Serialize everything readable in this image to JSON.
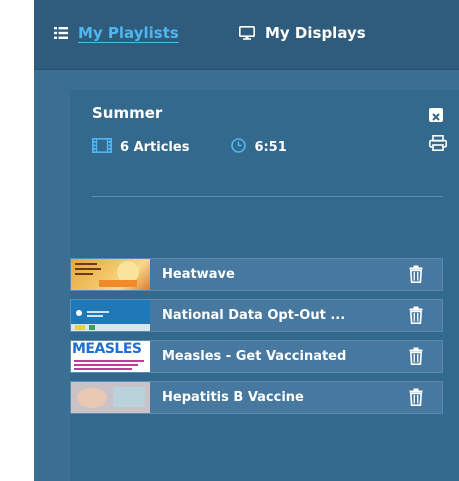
{
  "nav": {
    "playlists_label": "My Playlists",
    "displays_label": "My Displays"
  },
  "playlist": {
    "title": "Summer",
    "articles_count": "6 Articles",
    "duration": "6:51"
  },
  "articles": [
    {
      "title": "Heatwave",
      "thumb": "heatwave"
    },
    {
      "title": "National Data Opt-Out ...",
      "thumb": "data-opt-out"
    },
    {
      "title": "Measles - Get Vaccinated",
      "thumb": "measles",
      "thumb_text": "MEASLES"
    },
    {
      "title": "Hepatitis B Vaccine",
      "thumb": "hepatitis-b"
    }
  ],
  "icons": {
    "playlists": "list-icon",
    "displays": "monitor-icon",
    "articles": "film-icon",
    "duration": "clock-icon",
    "close": "close-icon",
    "print": "print-icon",
    "delete": "trash-icon"
  },
  "colors": {
    "nav_bg": "#2f5b7c",
    "app_bg": "#3a6e93",
    "active_link": "#4fb6f0",
    "row_bg": "#4779a0"
  }
}
